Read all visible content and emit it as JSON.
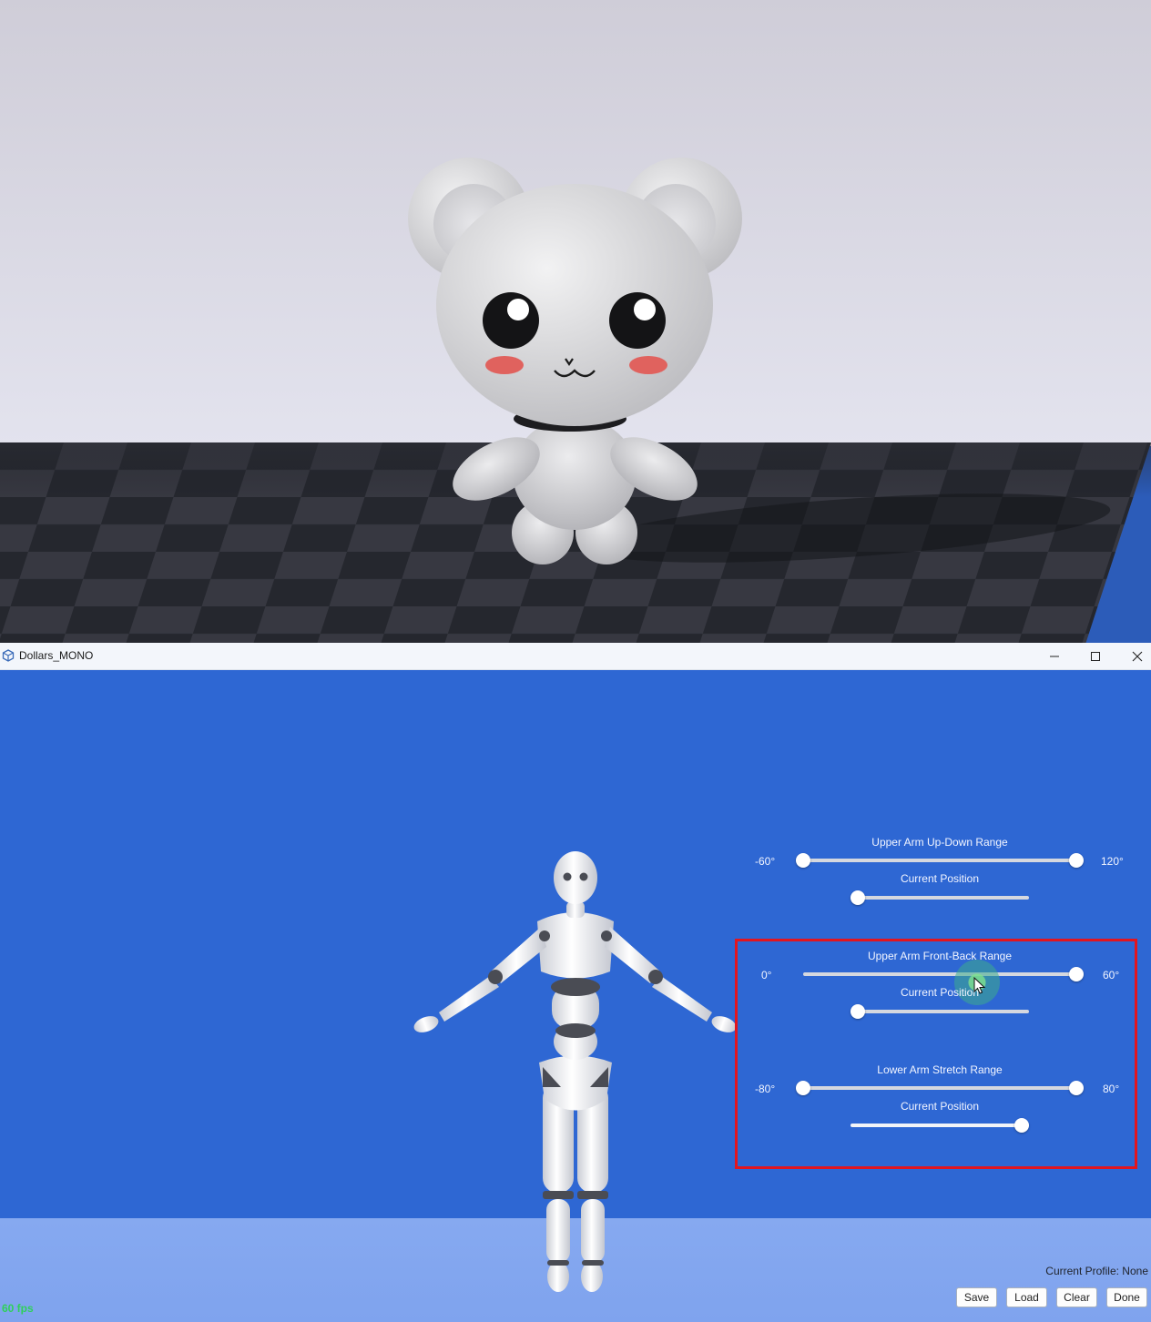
{
  "window": {
    "title": "Dollars_MONO"
  },
  "sliders": [
    {
      "title": "Upper Arm Up-Down Range",
      "min_label": "-60°",
      "max_label": "120°",
      "current_label": "Current Position",
      "range_low": 0.0,
      "range_high": 1.0,
      "current": 0.0
    },
    {
      "title": "Upper Arm Front-Back Range",
      "min_label": "0°",
      "max_label": "60°",
      "current_label": "Current Position",
      "range_low": 0.63,
      "range_high": 1.0,
      "current": 0.0
    },
    {
      "title": "Lower Arm Stretch Range",
      "min_label": "-80°",
      "max_label": "80°",
      "current_label": "Current Position",
      "range_low": 0.0,
      "range_high": 1.0,
      "current": 1.0
    }
  ],
  "profile": {
    "text": "Current Profile: None"
  },
  "buttons": {
    "save": "Save",
    "load": "Load",
    "clear": "Clear",
    "done": "Done"
  },
  "status": {
    "fps": "60 fps"
  },
  "colors": {
    "app_background": "#2e67d3",
    "highlight": "#e3151e",
    "fps": "#2fd05a"
  }
}
